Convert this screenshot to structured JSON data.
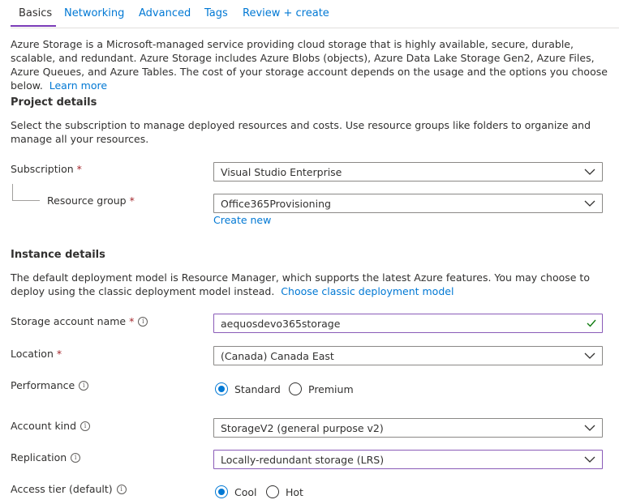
{
  "tabs": [
    "Basics",
    "Networking",
    "Advanced",
    "Tags",
    "Review + create"
  ],
  "intro": {
    "text": "Azure Storage is a Microsoft-managed service providing cloud storage that is highly available, secure, durable, scalable, and redundant. Azure Storage includes Azure Blobs (objects), Azure Data Lake Storage Gen2, Azure Files, Azure Queues, and Azure Tables. The cost of your storage account depends on the usage and the options you choose below.",
    "link": "Learn more"
  },
  "project": {
    "heading": "Project details",
    "description": "Select the subscription to manage deployed resources and costs. Use resource groups like folders to organize and manage all your resources.",
    "subscription_label": "Subscription",
    "subscription_value": "Visual Studio Enterprise",
    "resource_group_label": "Resource group",
    "resource_group_value": "Office365Provisioning",
    "create_new": "Create new"
  },
  "instance": {
    "heading": "Instance details",
    "description": "The default deployment model is Resource Manager, which supports the latest Azure features. You may choose to deploy using the classic deployment model instead.",
    "classic_link": "Choose classic deployment model",
    "storage_name_label": "Storage account name",
    "storage_name_value": "aequosdevo365storage",
    "location_label": "Location",
    "location_value": "(Canada) Canada East",
    "performance_label": "Performance",
    "performance_options": [
      "Standard",
      "Premium"
    ],
    "performance_selected": "Standard",
    "account_kind_label": "Account kind",
    "account_kind_value": "StorageV2 (general purpose v2)",
    "replication_label": "Replication",
    "replication_value": "Locally-redundant storage (LRS)",
    "access_tier_label": "Access tier (default)",
    "access_tier_options": [
      "Cool",
      "Hot"
    ],
    "access_tier_selected": "Cool"
  },
  "colors": {
    "link": "#0078d4",
    "required": "#a4262c",
    "active_tab": "#7a3bb7",
    "valid_check": "#107c10"
  },
  "required_marker": "*",
  "info_glyph": "i"
}
